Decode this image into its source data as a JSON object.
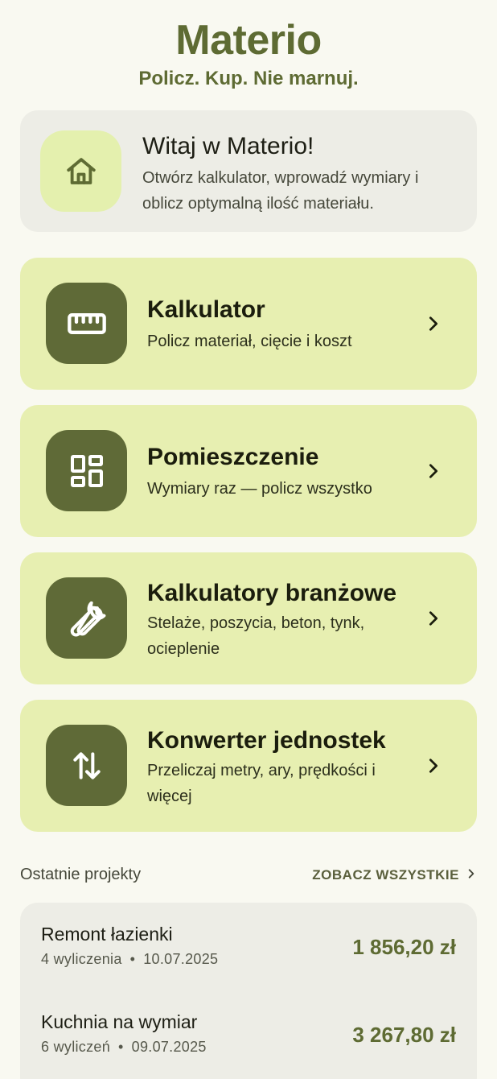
{
  "brand": {
    "title": "Materio",
    "tagline": "Policz. Kup. Nie marnuj."
  },
  "welcome": {
    "icon": "home-icon",
    "title": "Witaj w Materio!",
    "description": "Otwórz kalkulator, wprowadź wymiary i oblicz optymalną ilość materiału."
  },
  "cards": [
    {
      "icon": "ruler-icon",
      "title": "Kalkulator",
      "subtitle": "Policz materiał, cięcie i koszt"
    },
    {
      "icon": "dashboard-icon",
      "title": "Pomieszczenie",
      "subtitle": "Wymiary raz — policz wszystko"
    },
    {
      "icon": "wrench-icon",
      "title": "Kalkulatory branżowe",
      "subtitle": "Stelaże, poszycia, beton, tynk, ocieplenie"
    },
    {
      "icon": "swap-vertical-icon",
      "title": "Konwerter jednostek",
      "subtitle": "Przeliczaj metry, ary, prędkości i więcej"
    }
  ],
  "recent": {
    "title": "Ostatnie projekty",
    "see_all": "ZOBACZ WSZYSTKIE",
    "projects": [
      {
        "name": "Remont łazienki",
        "count": "4 wyliczenia",
        "separator": "•",
        "date": "10.07.2025",
        "price": "1 856,20 zł"
      },
      {
        "name": "Kuchnia na wymiar",
        "count": "6 wyliczeń",
        "separator": "•",
        "date": "09.07.2025",
        "price": "3 267,80 zł"
      }
    ]
  },
  "colors": {
    "background": "#f9f9f1",
    "brand": "#5e6b33",
    "card": "#e7efb1",
    "icon_tile": "#5f6a37",
    "surface": "#edede6"
  }
}
